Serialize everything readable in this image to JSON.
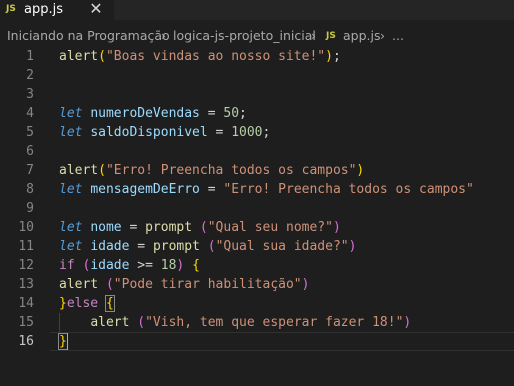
{
  "tab": {
    "badge": "JS",
    "filename": "app.js",
    "close": "✕"
  },
  "breadcrumb": {
    "items": [
      "Iniciando na Programação",
      "logica-js-projeto_inicial",
      "app.js",
      "..."
    ],
    "separator": "›",
    "file_badge": "JS"
  },
  "editor": {
    "active_line": 16,
    "lines": [
      {
        "n": "1",
        "t": "alert(\"Boas vindas ao nosso site!\");"
      },
      {
        "n": "2",
        "t": ""
      },
      {
        "n": "3",
        "t": ""
      },
      {
        "n": "4",
        "t": "let numeroDeVendas = 50;"
      },
      {
        "n": "5",
        "t": "let saldoDisponivel = 1000;"
      },
      {
        "n": "6",
        "t": ""
      },
      {
        "n": "7",
        "t": "alert(\"Erro! Preencha todos os campos\")"
      },
      {
        "n": "8",
        "t": "let mensagemDeErro = \"Erro! Preencha todos os campos\""
      },
      {
        "n": "9",
        "t": ""
      },
      {
        "n": "10",
        "t": "let nome = prompt (\"Qual seu nome?\")"
      },
      {
        "n": "11",
        "t": "let idade = prompt (\"Qual sua idade?\")"
      },
      {
        "n": "12",
        "t": "if (idade >= 18) {"
      },
      {
        "n": "13",
        "t": "alert (\"Pode tirar habilitação\")"
      },
      {
        "n": "14",
        "t": "}else {"
      },
      {
        "n": "15",
        "t": "    alert (\"Vish, tem que esperar fazer 18!\")"
      },
      {
        "n": "16",
        "t": "}"
      }
    ]
  },
  "colors": {
    "background": "#1e1e1e",
    "keyword": "#569cd6",
    "control": "#c586c0",
    "function": "#dcdcaa",
    "string": "#ce9178",
    "variable": "#9cdcfe",
    "number": "#b5cea8",
    "bracket": "#ffd700"
  }
}
